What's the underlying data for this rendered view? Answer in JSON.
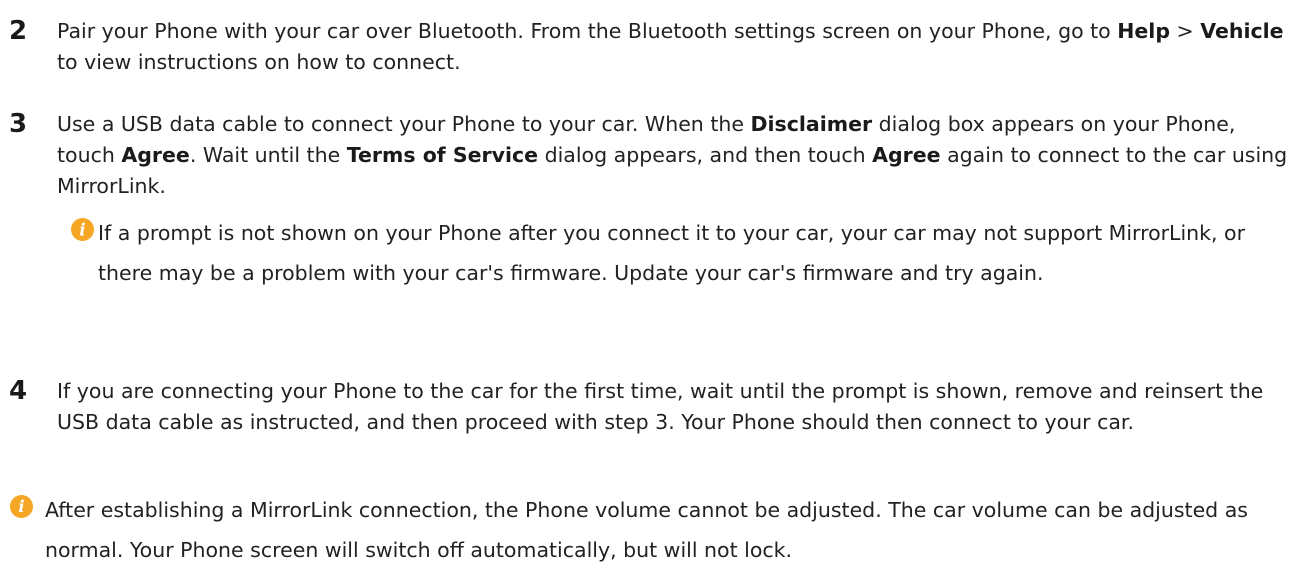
{
  "accent_color": "#f5a623",
  "icon_name": "info-icon",
  "steps": [
    {
      "number": "2",
      "parts": [
        {
          "t": "Pair your Phone with your car over Bluetooth. From the Bluetooth settings screen on your Phone, go to "
        },
        {
          "t": "Help",
          "b": true
        },
        {
          "t": " > "
        },
        {
          "t": "Vehicle",
          "b": true
        },
        {
          "t": " to view instructions on how to connect."
        }
      ]
    },
    {
      "number": "3",
      "parts": [
        {
          "t": "Use a USB data cable to connect your Phone to your car. When the "
        },
        {
          "t": "Disclaimer",
          "b": true
        },
        {
          "t": " dialog box appears on your Phone, touch "
        },
        {
          "t": "Agree",
          "b": true
        },
        {
          "t": ". Wait until the "
        },
        {
          "t": "Terms of Service",
          "b": true
        },
        {
          "t": " dialog appears, and then touch "
        },
        {
          "t": "Agree",
          "b": true
        },
        {
          "t": " again to connect to the car using MirrorLink."
        }
      ]
    },
    {
      "number": "4",
      "parts": [
        {
          "t": "If you are connecting your Phone to the car for the first time, wait until the prompt is shown, remove and reinsert the USB data cable as instructed, and then proceed with step 3. Your Phone should then connect to your car."
        }
      ]
    }
  ],
  "notes": {
    "step3_note": "If a prompt is not shown on your Phone after you connect it to your car, your car may not support MirrorLink, or there may be a problem with your car's firmware. Update your car's firmware and try again.",
    "final_note": "After establishing a MirrorLink connection, the Phone volume cannot be adjusted. The car volume can be adjusted as normal. Your Phone screen will switch off automatically, but will not lock."
  }
}
